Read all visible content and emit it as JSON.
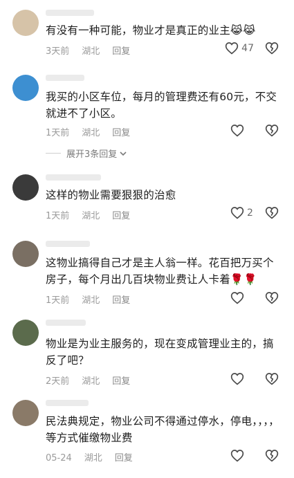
{
  "comments": [
    {
      "text": "有没有一种可能，物业才是真正的业主",
      "emoji": "😹😹",
      "time": "3天前",
      "location": "湖北",
      "reply": "回复",
      "likes": "47",
      "avatar": "#d6c3a8"
    },
    {
      "text": "我买的小区车位，每月的管理费还有60元，不交就进不了小区。",
      "emoji": "",
      "time": "1天前",
      "location": "湖北",
      "reply": "回复",
      "likes": "",
      "avatar": "#3d8fd1",
      "expand": "展开3条回复"
    },
    {
      "text": "这样的物业需要狠狠的治愈",
      "emoji": "",
      "time": "1天前",
      "location": "湖北",
      "reply": "回复",
      "likes": "2",
      "avatar": "#3a3a3a"
    },
    {
      "text": "这物业搞得自己才是主人翁一样。花百把万买个房子，每个月出几百块物业费让人卡着",
      "emoji": "🌹🌹",
      "time": "1天前",
      "location": "湖北",
      "reply": "回复",
      "likes": "",
      "avatar": "#7a6f63"
    },
    {
      "text": "物业是为业主服务的，现在变成管理业主的，搞反了吧？",
      "emoji": "",
      "time": "2天前",
      "location": "湖北",
      "reply": "回复",
      "likes": "",
      "avatar": "#5b6b4c"
    },
    {
      "text": "民法典规定，物业公司不得通过停水，停电，，，，等方式催缴物业费",
      "emoji": "",
      "time": "05-24",
      "location": "湖北",
      "reply": "回复",
      "likes": "",
      "avatar": "#8a7a68"
    }
  ],
  "colors": {
    "meta": "#9a9a9a",
    "text": "#1e1e1e"
  },
  "icons": {
    "like": "heart-outline-icon",
    "dislike": "broken-heart-icon",
    "expand": "chevron-down-icon"
  }
}
